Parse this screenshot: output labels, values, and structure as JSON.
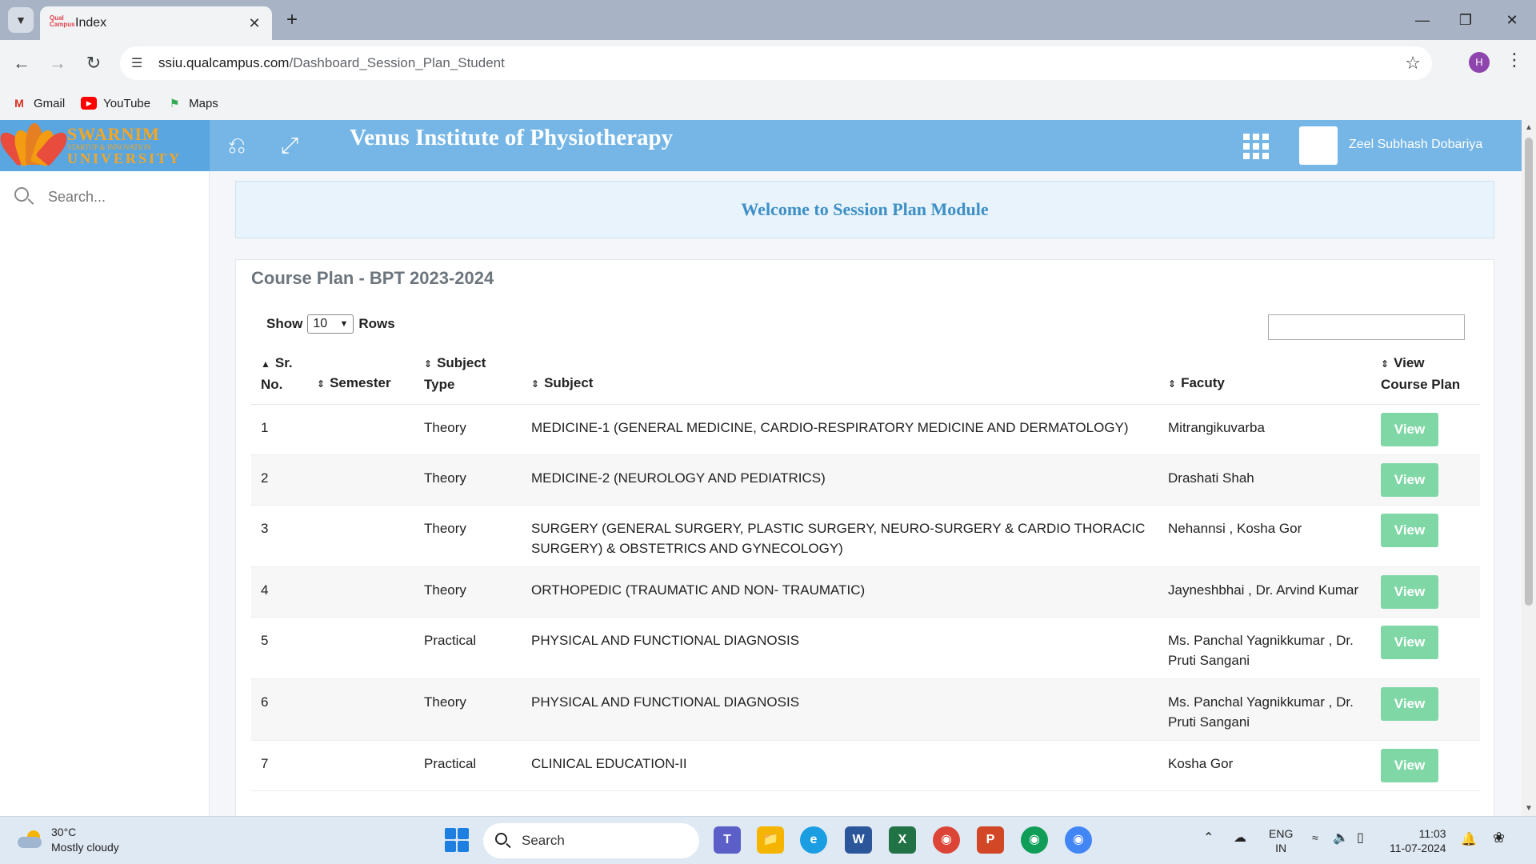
{
  "browser": {
    "tab_title": "Index",
    "url_host": "ssiu.qualcampus.com",
    "url_path": "/Dashboard_Session_Plan_Student",
    "profile_initial": "H",
    "bookmarks": [
      {
        "label": "Gmail",
        "icon": "gmail-icon",
        "color": "#d93025"
      },
      {
        "label": "YouTube",
        "icon": "youtube-icon",
        "color": "#ff0000"
      },
      {
        "label": "Maps",
        "icon": "maps-icon",
        "color": "#34a853"
      }
    ]
  },
  "header": {
    "logo_line1": "SWARNIM",
    "logo_line2": "STARTUP & INNOVATION",
    "logo_line3": "UNIVERSITY",
    "institute": "Venus Institute of Physiotherapy",
    "user_name": "Zeel Subhash Dobariya",
    "header_color": "#76b6e6"
  },
  "sidebar": {
    "search_placeholder": "Search..."
  },
  "welcome": "Welcome to Session Plan Module",
  "course_plan": {
    "title": "Course Plan - BPT 2023-2024",
    "show_label": "Show",
    "rows_value": "10",
    "rows_label": "Rows",
    "columns": {
      "sr_line1": "Sr.",
      "sr_line2": "No.",
      "semester": "Semester",
      "subject_type_line1": "Subject",
      "subject_type_line2": "Type",
      "subject": "Subject",
      "faculty": "Facuty",
      "view_line1": "View",
      "view_line2": "Course Plan"
    },
    "view_label": "View",
    "view_color": "#7fd7a6",
    "rows": [
      {
        "sr": "1",
        "semester": "",
        "type": "Theory",
        "subject": "MEDICINE-1 (GENERAL MEDICINE, CARDIO-RESPIRATORY MEDICINE AND DERMATOLOGY)",
        "faculty": "Mitrangikuvarba"
      },
      {
        "sr": "2",
        "semester": "",
        "type": "Theory",
        "subject": "MEDICINE-2 (NEUROLOGY AND PEDIATRICS)",
        "faculty": "Drashati Shah"
      },
      {
        "sr": "3",
        "semester": "",
        "type": "Theory",
        "subject": "SURGERY (GENERAL SURGERY, PLASTIC SURGERY, NEURO-SURGERY & CARDIO THORACIC SURGERY) & OBSTETRICS AND GYNECOLOGY)",
        "faculty": "Nehannsi , Kosha Gor"
      },
      {
        "sr": "4",
        "semester": "",
        "type": "Theory",
        "subject": "ORTHOPEDIC (TRAUMATIC AND NON- TRAUMATIC)",
        "faculty": "Jayneshbhai , Dr. Arvind Kumar"
      },
      {
        "sr": "5",
        "semester": "",
        "type": "Practical",
        "subject": "PHYSICAL AND FUNCTIONAL DIAGNOSIS",
        "faculty": "Ms. Panchal Yagnikkumar , Dr. Pruti Sangani"
      },
      {
        "sr": "6",
        "semester": "",
        "type": "Theory",
        "subject": "PHYSICAL AND FUNCTIONAL DIAGNOSIS",
        "faculty": "Ms. Panchal Yagnikkumar , Dr. Pruti Sangani"
      },
      {
        "sr": "7",
        "semester": "",
        "type": "Practical",
        "subject": "CLINICAL EDUCATION-II",
        "faculty": "Kosha Gor"
      }
    ]
  },
  "taskbar": {
    "temperature": "30°C",
    "weather": "Mostly cloudy",
    "search_label": "Search",
    "lang_line1": "ENG",
    "lang_line2": "IN",
    "time": "11:03",
    "date": "11-07-2024"
  }
}
